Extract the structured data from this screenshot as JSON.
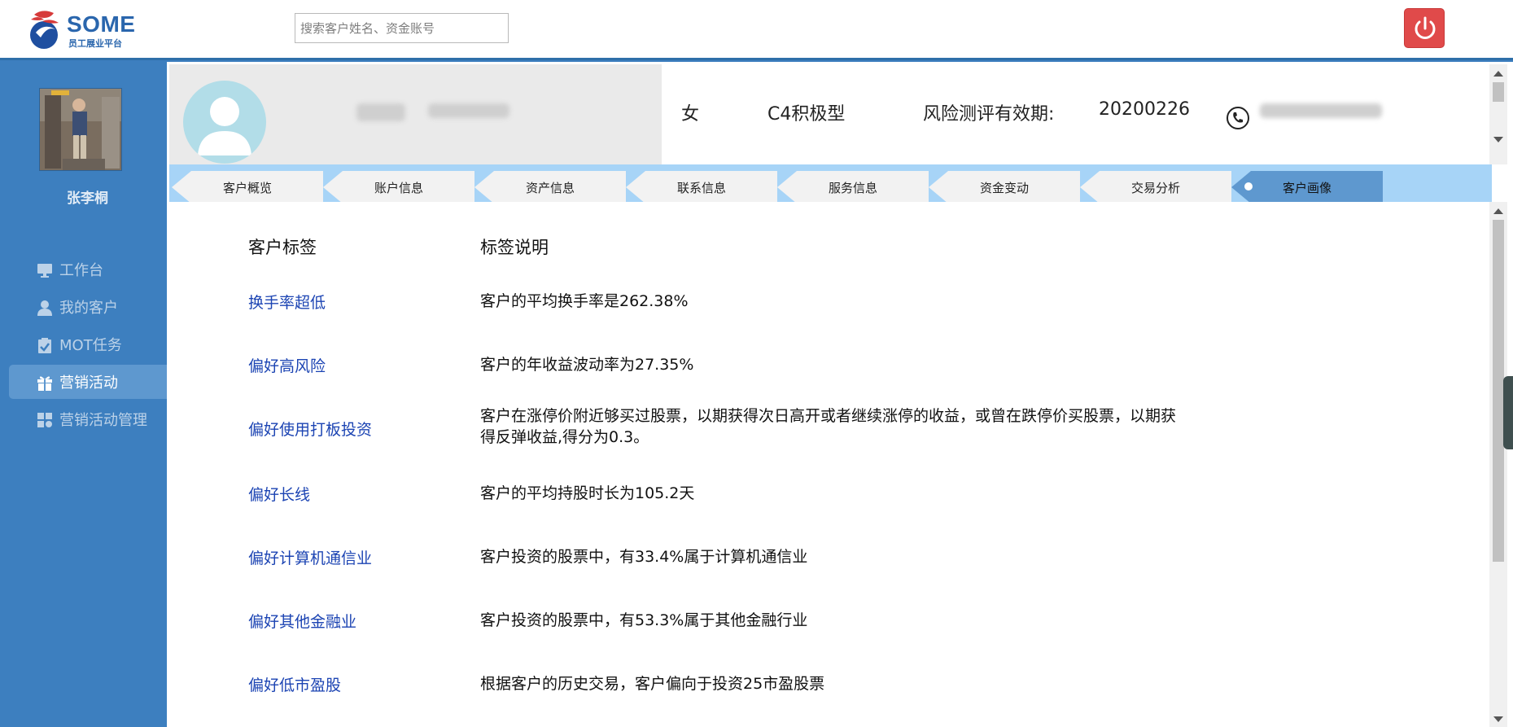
{
  "header": {
    "brand": "SOME",
    "brand_sub": "员工展业平台",
    "search_placeholder": "搜索客户姓名、资金账号"
  },
  "sidebar": {
    "user_name": "张李桐",
    "items": [
      {
        "label": "工作台",
        "icon": "monitor-icon",
        "active": false
      },
      {
        "label": "我的客户",
        "icon": "user-icon",
        "active": false
      },
      {
        "label": "MOT任务",
        "icon": "clipboard-check-icon",
        "active": false
      },
      {
        "label": "营销活动",
        "icon": "gift-icon",
        "active": true
      },
      {
        "label": "营销活动管理",
        "icon": "grid-settings-icon",
        "active": false
      }
    ]
  },
  "profile": {
    "gender": "女",
    "risk_level": "C4积极型",
    "risk_eval_label": "风险测评有效期:",
    "risk_eval_date": "20200226"
  },
  "tabs": [
    {
      "label": "客户概览",
      "active": false
    },
    {
      "label": "账户信息",
      "active": false
    },
    {
      "label": "资产信息",
      "active": false
    },
    {
      "label": "联系信息",
      "active": false
    },
    {
      "label": "服务信息",
      "active": false
    },
    {
      "label": "资金变动",
      "active": false
    },
    {
      "label": "交易分析",
      "active": false
    },
    {
      "label": "客户画像",
      "active": true
    }
  ],
  "tags_table": {
    "header_tag": "客户标签",
    "header_desc": "标签说明",
    "rows": [
      {
        "tag": "换手率超低",
        "desc": "客户的平均换手率是262.38%"
      },
      {
        "tag": "偏好高风险",
        "desc": "客户的年收益波动率为27.35%"
      },
      {
        "tag": "偏好使用打板投资",
        "desc": "客户在涨停价附近够买过股票，以期获得次日高开或者继续涨停的收益，或曾在跌停价买股票，以期获得反弹收益,得分为0.3。"
      },
      {
        "tag": "偏好长线",
        "desc": "客户的平均持股时长为105.2天"
      },
      {
        "tag": "偏好计算机通信业",
        "desc": "客户投资的股票中，有33.4%属于计算机通信业"
      },
      {
        "tag": "偏好其他金融业",
        "desc": "客户投资的股票中，有53.3%属于其他金融行业"
      },
      {
        "tag": "偏好低市盈股",
        "desc": "根据客户的历史交易，客户偏向于投资25市盈股票"
      }
    ]
  },
  "colors": {
    "sidebar_bg": "#3d7fbf",
    "active_item": "#5e98cf",
    "tab_bar": "#a7d4f7",
    "tag_link": "#1c44b3",
    "logout": "#e04a4a"
  }
}
